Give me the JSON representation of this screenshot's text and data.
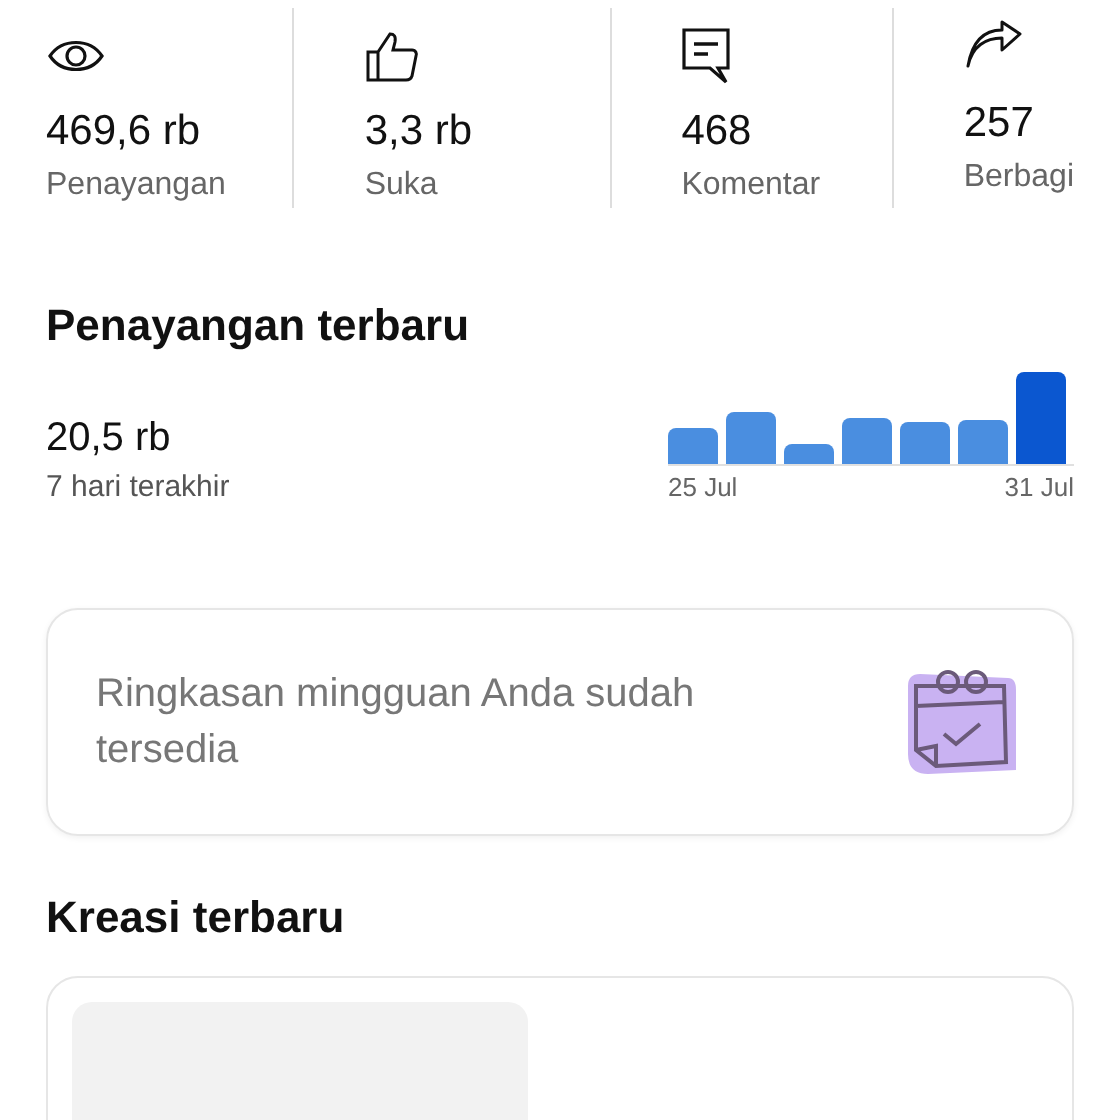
{
  "stats": [
    {
      "value": "469,6 rb",
      "label": "Penayangan"
    },
    {
      "value": "3,3 rb",
      "label": "Suka"
    },
    {
      "value": "468",
      "label": "Komentar"
    },
    {
      "value": "257",
      "label": "Berbagi"
    }
  ],
  "recent_views": {
    "title": "Penayangan terbaru",
    "value": "20,5 rb",
    "period": "7 hari terakhir",
    "start_label": "25 Jul",
    "end_label": "31 Jul"
  },
  "weekly_summary": {
    "text": "Ringkasan mingguan Anda sudah tersedia"
  },
  "recent_creations": {
    "title": "Kreasi terbaru"
  }
}
